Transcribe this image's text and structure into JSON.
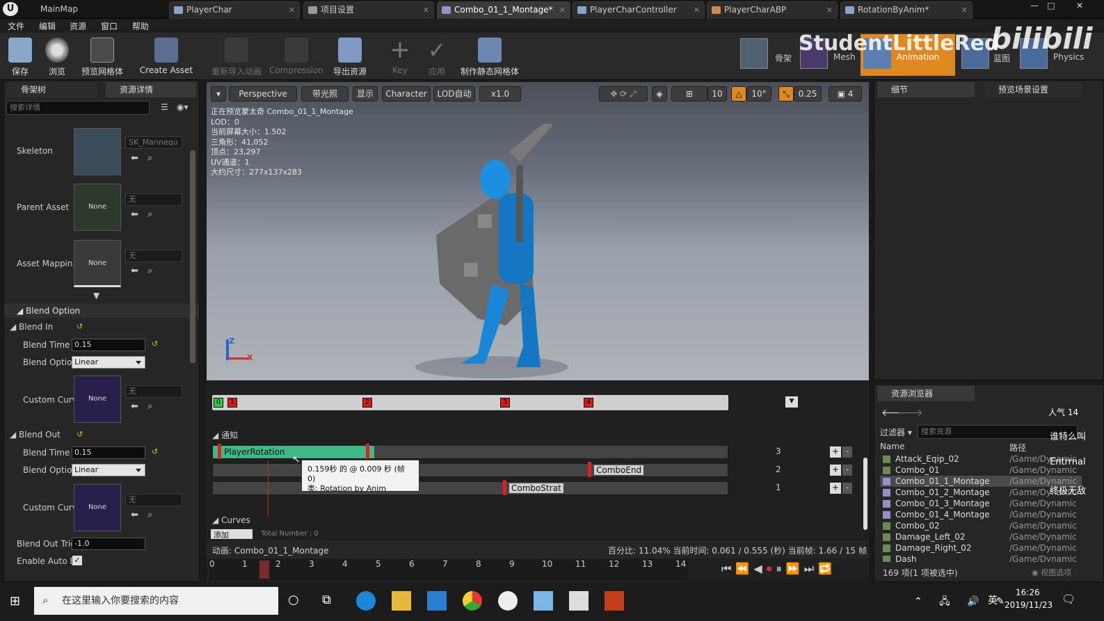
{
  "titlebar": {
    "tabs": [
      "MainMap",
      "PlayerChar",
      "项目设置",
      "Combo_01_1_Montage*",
      "PlayerCharController",
      "PlayerCharABP",
      "RotationByAnim*"
    ],
    "window_buttons": [
      "—",
      "□",
      "✕"
    ]
  },
  "menubar": {
    "items": [
      "文件",
      "编辑",
      "资源",
      "窗口",
      "帮助"
    ]
  },
  "toolbar": {
    "buttons": [
      "保存",
      "浏览",
      "预览网格体",
      "Create Asset",
      "重新导入动画",
      "Compression",
      "导出资源",
      "Key",
      "应用",
      "制作静态网格体"
    ],
    "modes": [
      "骨架",
      "Mesh",
      "Animation",
      "蓝图",
      "Physics"
    ]
  },
  "watermark": {
    "text": "StudentLittleRed",
    "logo": "bilibili"
  },
  "left_panel": {
    "tabs": [
      "骨架树",
      "资源详情"
    ],
    "search_placeholder": "搜索详情",
    "rows": {
      "skeleton": {
        "label": "Skeleton",
        "value": "SK_Mannequ"
      },
      "parent_asset": {
        "label": "Parent Asset",
        "thumb": "None",
        "value": "无"
      },
      "asset_mapping": {
        "label": "Asset Mappin",
        "thumb": "None",
        "value": "无"
      }
    },
    "blend_option": {
      "title": "Blend Option",
      "blend_in": {
        "title": "Blend In",
        "blend_time_label": "Blend Time",
        "blend_time": "0.15",
        "blend_option_label": "Blend Optior",
        "blend_option": "Linear",
        "custom_curve_label": "Custom Curv",
        "custom_curve_thumb": "None",
        "custom_curve_value": "无"
      },
      "blend_out": {
        "title": "Blend Out",
        "blend_time_label": "Blend Time",
        "blend_time": "0.15",
        "blend_option_label": "Blend Optior",
        "blend_option": "Linear",
        "custom_curve_label": "Custom Curv",
        "custom_curve_thumb": "None",
        "custom_curve_value": "无",
        "trigger_label": "Blend Out Trig",
        "trigger": "-1.0",
        "auto_label": "Enable Auto B"
      }
    }
  },
  "viewport": {
    "buttons": [
      "Perspective",
      "带光照",
      "显示",
      "Character",
      "LOD自动",
      "x1.0"
    ],
    "right_values": [
      "10",
      "10°",
      "0.25",
      "4"
    ],
    "stats": [
      "正在预览蒙太奇 Combo_01_1_Montage",
      "LOD：0",
      "当前屏幕大小：1.502",
      "三角形：41,052",
      "顶点：23,297",
      "UV通道：1",
      "大约尺寸：277x137x283"
    ],
    "axis_z": "Z",
    "axis_x": "X"
  },
  "timeline": {
    "section_markers": [
      "0",
      "1",
      "2",
      "3",
      "4"
    ],
    "notify_title": "通知",
    "notify_tracks": [
      {
        "name": "PlayerRotation",
        "index": "3"
      },
      {
        "name": "ComboEnd",
        "index": "2"
      },
      {
        "name": "ComboStrat",
        "index": "1"
      }
    ],
    "tooltip_line1": "0.159秒 的 @ 0.009 秒 (帧 0)",
    "tooltip_line2": "类: Rotation by Anim",
    "curves_title": "Curves",
    "curves_add": "添加",
    "curves_total": "Total Number : 0",
    "anim_label": "动画:  Combo_01_1_Montage",
    "status": "百分比:  11.04%  当前时间:  0.061 / 0.555 (秒)  当前帧:  1.66 / 15 帧",
    "ruler": [
      "0",
      "1",
      "2",
      "3",
      "4",
      "5",
      "6",
      "7",
      "8",
      "9",
      "10",
      "11",
      "12",
      "13",
      "14"
    ]
  },
  "right_panel": {
    "tabs": [
      "细节",
      "预览场景设置"
    ]
  },
  "asset_browser": {
    "title": "资源浏览器",
    "popularity": "人气 14",
    "filter": "过滤器",
    "search_placeholder": "搜索资源",
    "col_name": "Name",
    "col_path": "路径",
    "rows": [
      {
        "name": "Attack_Eqip_02",
        "path": "/Game/Dynamic"
      },
      {
        "name": "Combo_01",
        "path": "/Game/Dynamic"
      },
      {
        "name": "Combo_01_1_Montage",
        "path": "/Game/Dynamic"
      },
      {
        "name": "Combo_01_2_Montage",
        "path": "/Game/Dynamic"
      },
      {
        "name": "Combo_01_3_Montage",
        "path": "/Game/Dynamic"
      },
      {
        "name": "Combo_01_4_Montage",
        "path": "/Game/Dynamic"
      },
      {
        "name": "Combo_02",
        "path": "/Game/Dynamic"
      },
      {
        "name": "Damage_Left_02",
        "path": "/Game/Dynamic"
      },
      {
        "name": "Damage_Right_02",
        "path": "/Game/Dynamic"
      },
      {
        "name": "Dash",
        "path": "/Game/Dynamic"
      }
    ],
    "count": "169 项(1 项被选中)",
    "view_options": "视图选项",
    "danmaku": [
      "谁特么叫",
      "Entrrnal",
      "终极无敌"
    ]
  },
  "taskbar": {
    "search_placeholder": "在这里输入你要搜索的内容",
    "time": "16:26",
    "date": "2019/11/23",
    "ime": "英"
  }
}
